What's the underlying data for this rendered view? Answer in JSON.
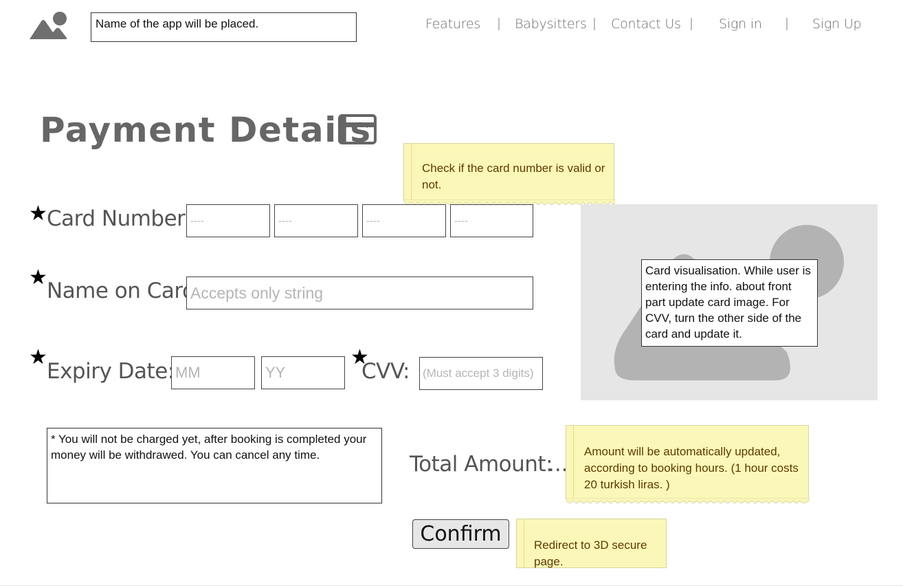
{
  "header": {
    "app_name_placeholder": "Name of the app will be placed.",
    "nav": [
      "Features",
      "Babysitters",
      "Contact Us",
      "Sign in",
      "Sign Up"
    ]
  },
  "page": {
    "title": "Payment Details"
  },
  "form": {
    "card_number_label": "Card Number :",
    "card_number_placeholders": [
      "----",
      "----",
      "----",
      "----"
    ],
    "name_label": "Name on Card:",
    "name_placeholder": "Accepts only string",
    "expiry_label": "Expiry Date:",
    "expiry_mm_placeholder": "MM",
    "expiry_yy_placeholder": "YY",
    "cvv_label": "CVV:",
    "cvv_placeholder": "(Must accept 3 digits)",
    "required_marker": "★"
  },
  "notes": {
    "card_check": "Check if the card number is valid or not.",
    "card_visual": "Card visualisation. While user is entering the info. about front part update card image. For CVV, turn the other side of the card and update it.",
    "charge": "* You will not be charged yet, after booking is completed your money will be withdrawed. You can cancel any time.",
    "amount": "Amount will be automatically updated, according to booking hours. (1 hour costs 20 turkish liras. )",
    "redirect": "Redirect to 3D secure page."
  },
  "total": {
    "label": "Total Amount:",
    "value": "...."
  },
  "confirm_label": "Confirm",
  "icons": {
    "logo": "image-placeholder-icon",
    "card": "credit-card-icon"
  },
  "colors": {
    "sticky": "#fbf7b8",
    "sticky_text": "#5c3a00",
    "label_gray": "#555555",
    "placeholder_gray": "#b5b5b5"
  }
}
